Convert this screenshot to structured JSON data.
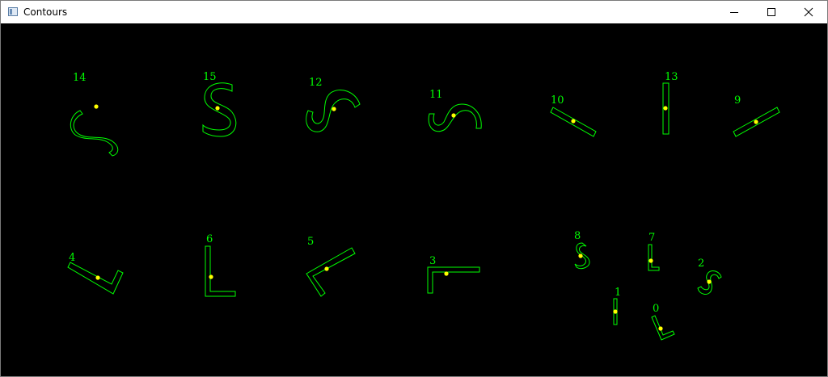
{
  "window": {
    "title": "Contours",
    "icon": "window-app-icon",
    "controls": {
      "minimize_icon": "minimize-icon",
      "maximize_icon": "maximize-icon",
      "close_icon": "close-icon"
    }
  },
  "colors": {
    "background": "#000000",
    "contour": "#00ff00",
    "centroid": "#ffff00",
    "label": "#00ff00"
  },
  "contour_labels": {
    "c14": "14",
    "c15": "15",
    "c12": "12",
    "c11": "11",
    "c10": "10",
    "c13": "13",
    "c9": "9",
    "c4": "4",
    "c6": "6",
    "c5": "5",
    "c3": "3",
    "c8": "8",
    "c7": "7",
    "c2": "2",
    "c1": "1",
    "c0": "0"
  }
}
